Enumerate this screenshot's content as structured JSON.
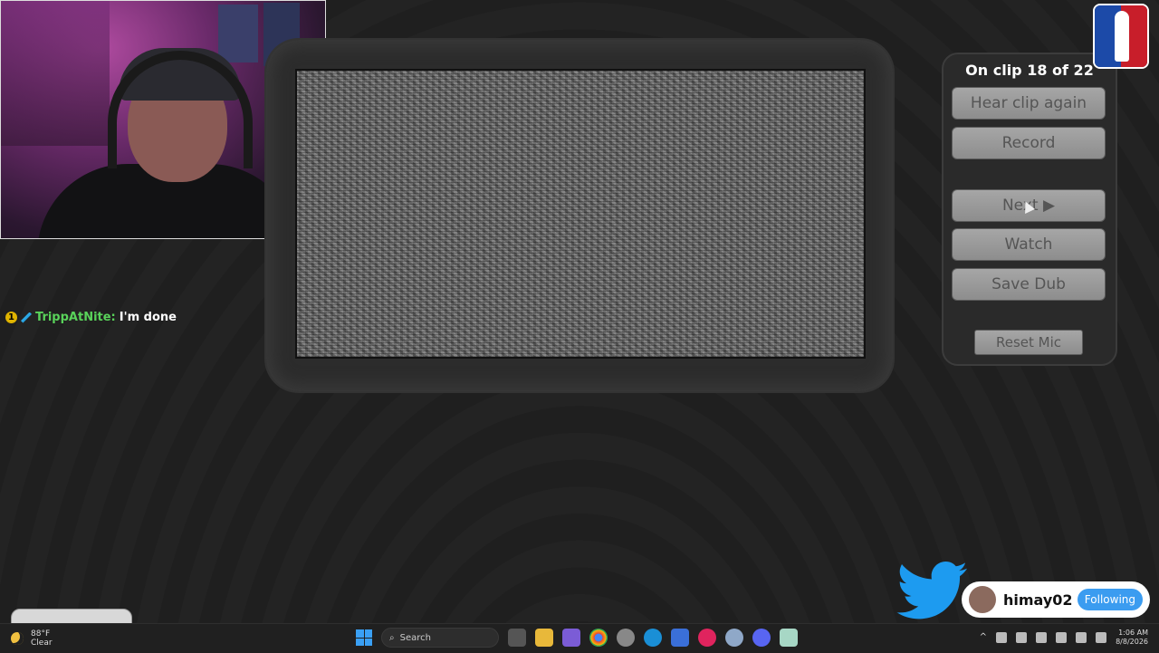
{
  "panel": {
    "clip_status": "On clip 18 of 22",
    "buttons": {
      "hear_again": "Hear clip again",
      "record": "Record",
      "next": "Next ▶",
      "watch": "Watch",
      "save_dub": "Save Dub",
      "reset_mic": "Reset Mic"
    }
  },
  "chat": {
    "badge": "1",
    "username": "TrippAtNite:",
    "message": "I'm done"
  },
  "twitter": {
    "handle": "himay02",
    "follow_label": "Following"
  },
  "taskbar": {
    "weather_temp": "88°F",
    "weather_desc": "Clear",
    "search_placeholder": "Search",
    "time": "1:06 AM",
    "date": "8/8/2026"
  },
  "colors": {
    "background": "#222222",
    "button": "#9a9a9a",
    "chat_username": "#59d25a",
    "twitter_blue": "#1d9bf0",
    "logo_blue": "#1c4aa8",
    "logo_red": "#c81e2a"
  },
  "icons": [
    "twitter-bird-icon",
    "windows-start-icon",
    "search-icon",
    "moon-icon",
    "cursor-icon",
    "league-logo"
  ]
}
